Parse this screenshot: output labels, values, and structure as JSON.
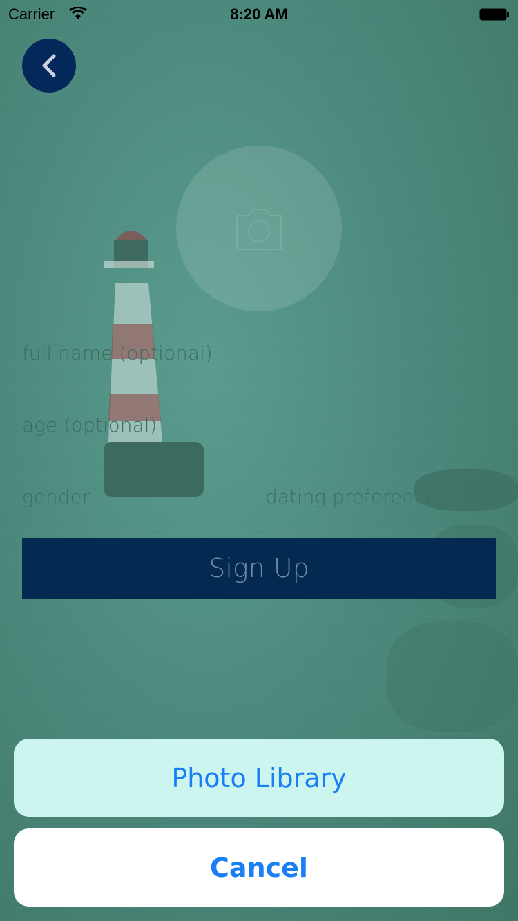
{
  "status_bar": {
    "carrier": "Carrier",
    "time": "8:20 AM"
  },
  "avatar": {
    "icon": "camera-icon"
  },
  "form": {
    "full_name_placeholder": "full name (optional)",
    "age_placeholder": "age (optional)",
    "gender_placeholder": "gender",
    "dating_preference_placeholder": "dating preference",
    "signup_label": "Sign Up"
  },
  "action_sheet": {
    "photo_library_label": "Photo Library",
    "cancel_label": "Cancel"
  },
  "colors": {
    "primary": "#05285a",
    "action_blue": "#1a7ef5",
    "background_teal": "#4c8a7d"
  }
}
